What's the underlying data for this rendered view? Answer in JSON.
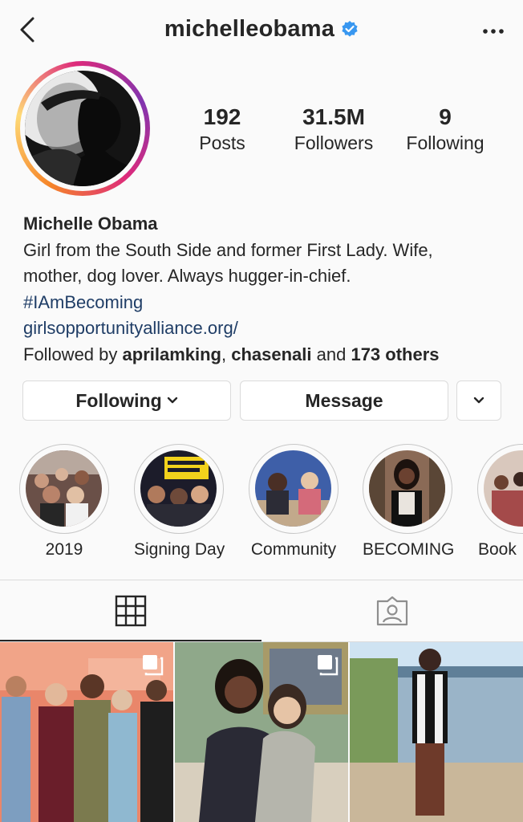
{
  "header": {
    "username": "michelleobama",
    "back_icon": "chevron-left-icon",
    "verified_icon": "verified-badge-icon",
    "more_icon": "more-horizontal-icon"
  },
  "stats": {
    "posts": {
      "value": "192",
      "label": "Posts"
    },
    "followers": {
      "value": "31.5M",
      "label": "Followers"
    },
    "following": {
      "value": "9",
      "label": "Following"
    }
  },
  "bio": {
    "name": "Michelle Obama",
    "line1": "Girl from the South Side and former First Lady. Wife,",
    "line2": "mother, dog lover. Always hugger-in-chief.",
    "hashtag": "#IAmBecoming",
    "link": "girlsopportunityalliance.org/",
    "followed_by_prefix": "Followed by ",
    "followed_user1": "aprilamking",
    "followed_sep": ", ",
    "followed_user2": "chasenali",
    "followed_and": " and ",
    "followed_others": "173 others"
  },
  "actions": {
    "following_label": "Following",
    "message_label": "Message"
  },
  "highlights": [
    {
      "label": "2019"
    },
    {
      "label": "Signing Day"
    },
    {
      "label": "Community"
    },
    {
      "label": "BECOMING"
    },
    {
      "label": "Book"
    }
  ],
  "tabs": {
    "grid_icon": "grid-icon",
    "tagged_icon": "tagged-person-icon"
  },
  "colors": {
    "link": "#1f3d66",
    "verified": "#3897f0",
    "text": "#262626",
    "border": "#dbdbdb"
  }
}
